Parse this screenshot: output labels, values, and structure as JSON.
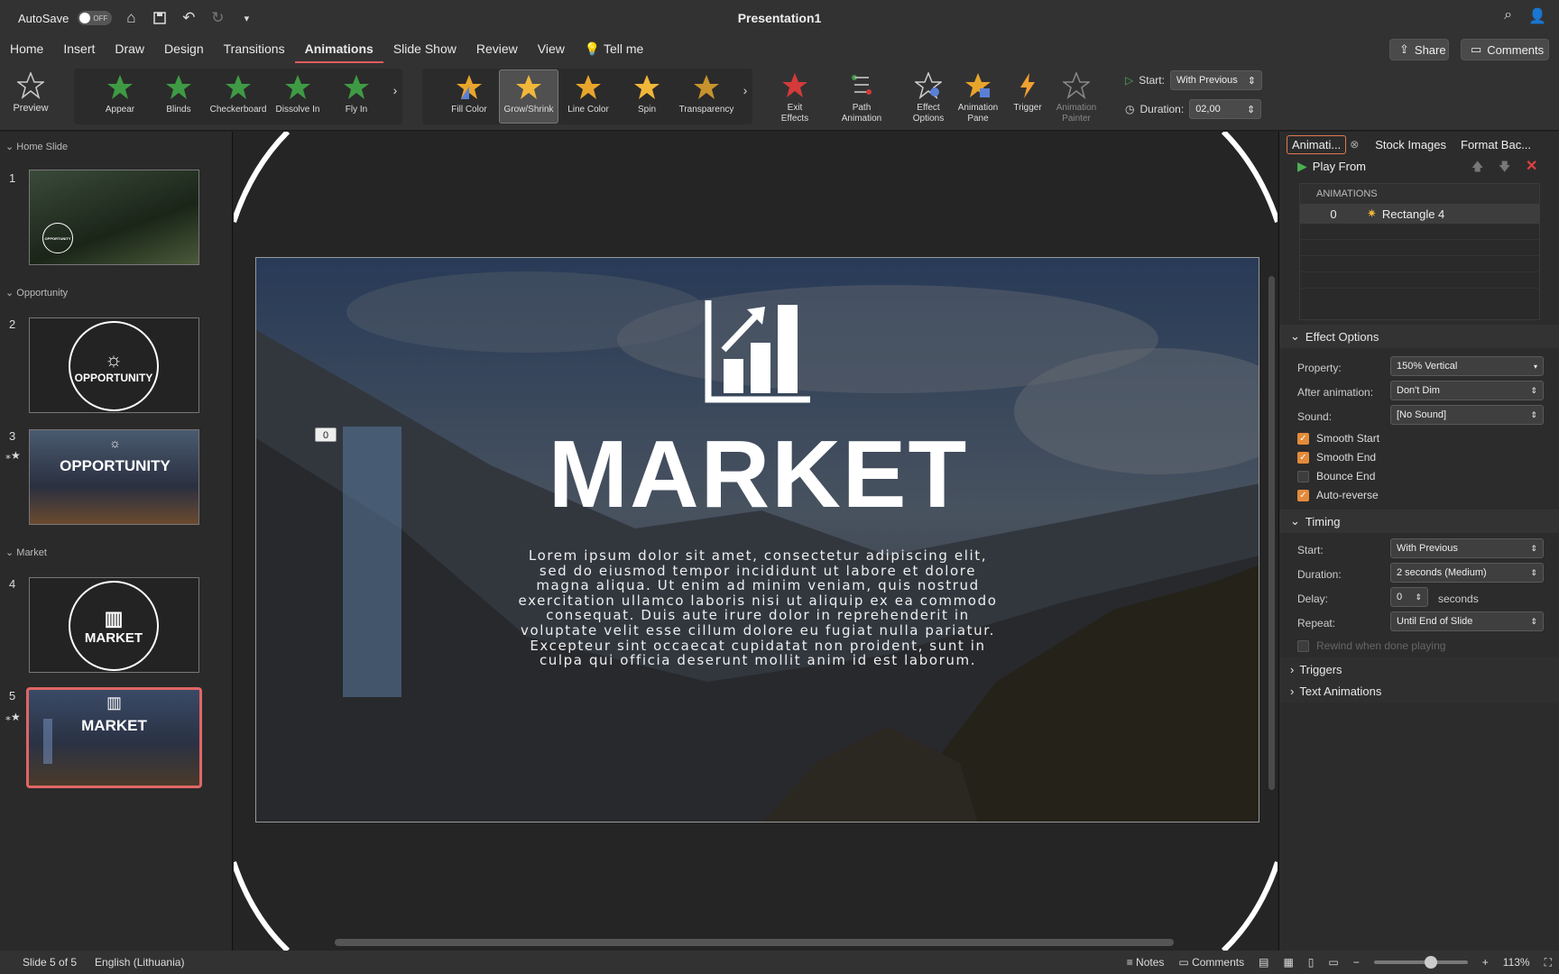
{
  "window": {
    "autosave_label": "AutoSave",
    "autosave_state": "OFF",
    "title": "Presentation1"
  },
  "menu": {
    "items": [
      "Home",
      "Insert",
      "Draw",
      "Design",
      "Transitions",
      "Animations",
      "Slide Show",
      "Review",
      "View",
      "Tell me"
    ],
    "active": "Animations",
    "share": "Share",
    "comments": "Comments"
  },
  "ribbon": {
    "preview": "Preview",
    "entrance": [
      "Appear",
      "Blinds",
      "Checkerboard",
      "Dissolve In",
      "Fly In"
    ],
    "emphasis": [
      "Fill Color",
      "Grow/Shrink",
      "Line Color",
      "Spin",
      "Transparency"
    ],
    "selected_effect": "Grow/Shrink",
    "exit": "Exit Effects",
    "path": "Path Animation",
    "effect_options": "Effect Options",
    "animation_pane": "Animation Pane",
    "trigger": "Trigger",
    "animation_painter": "Animation Painter",
    "start_label": "Start:",
    "start_value": "With Previous",
    "duration_label": "Duration:",
    "duration_value": "02,00"
  },
  "slides_pane": {
    "sections": [
      "Home Slide",
      "Opportunity",
      "Market"
    ],
    "slides": [
      {
        "num": "1",
        "label": "OPPORTUNITY"
      },
      {
        "num": "2",
        "label": "OPPORTUNITY"
      },
      {
        "num": "3",
        "label": "OPPORTUNITY"
      },
      {
        "num": "4",
        "label": "MARKET"
      },
      {
        "num": "5",
        "label": "MARKET"
      }
    ]
  },
  "slide": {
    "title": "MARKET",
    "body": "Lorem ipsum dolor sit amet, consectetur adipiscing elit, sed do eiusmod tempor incididunt ut labore et dolore magna aliqua. Ut enim ad minim veniam, quis nostrud exercitation ullamco laboris nisi ut aliquip ex ea commodo consequat. Duis aute irure dolor in reprehenderit in voluptate velit esse cillum dolore eu fugiat nulla pariatur. Excepteur sint occaecat cupidatat non proident, sunt in culpa qui officia deserunt mollit anim id est laborum.",
    "anim_tag": "0"
  },
  "anim_pane": {
    "tabs": [
      "Animati...",
      "Stock Images",
      "Format Bac..."
    ],
    "play_from": "Play From",
    "list_header": "ANIMATIONS",
    "items": [
      {
        "order": "0",
        "name": "Rectangle 4"
      }
    ],
    "effect_options": "Effect Options",
    "property_label": "Property:",
    "property_value": "150% Vertical",
    "after_label": "After animation:",
    "after_value": "Don't Dim",
    "sound_label": "Sound:",
    "sound_value": "[No Sound]",
    "checks": [
      {
        "label": "Smooth Start",
        "checked": true
      },
      {
        "label": "Smooth End",
        "checked": true
      },
      {
        "label": "Bounce End",
        "checked": false
      },
      {
        "label": "Auto-reverse",
        "checked": true
      }
    ],
    "timing": "Timing",
    "start_label": "Start:",
    "start_value": "With Previous",
    "duration_label": "Duration:",
    "duration_value": "2 seconds (Medium)",
    "delay_label": "Delay:",
    "delay_value": "0",
    "delay_unit": "seconds",
    "repeat_label": "Repeat:",
    "repeat_value": "Until End of Slide",
    "rewind": "Rewind when done playing",
    "triggers": "Triggers",
    "text_animations": "Text Animations"
  },
  "status": {
    "slide_info": "Slide 5 of 5",
    "language": "English (Lithuania)",
    "notes": "Notes",
    "comments": "Comments",
    "zoom": "113%"
  },
  "colors": {
    "accent": "#e05d5d",
    "check": "#e38b3a",
    "star_green": "#3f9a44",
    "star_gold": "#e8a52c",
    "star_red": "#d43a3a"
  }
}
